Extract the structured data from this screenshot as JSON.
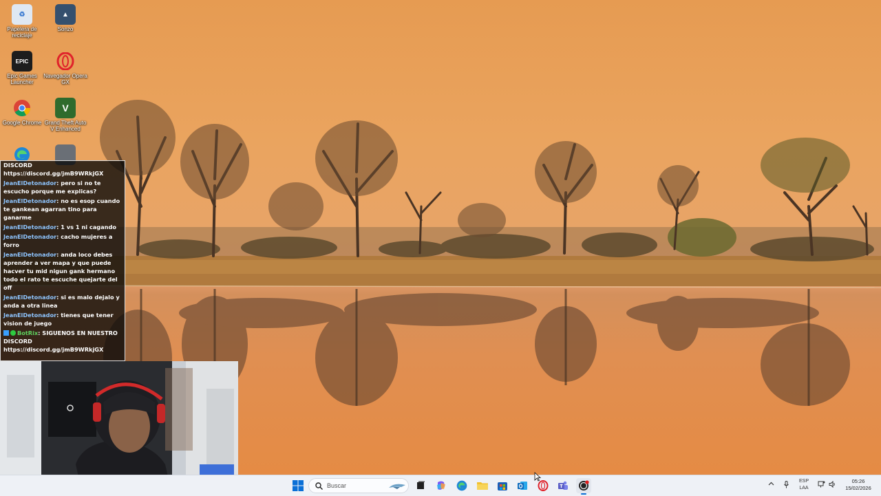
{
  "desktop": {
    "icons": [
      {
        "label": "Papelera de reciclaje",
        "icon": "recycle-bin-icon",
        "color": "#dfe8f3"
      },
      {
        "label": "Sonzo",
        "icon": "game-shortcut-icon",
        "color": "#35506e"
      },
      {
        "label": "Epic Games Launcher",
        "icon": "epic-games-icon",
        "color": "#1d1d1d"
      },
      {
        "label": "Navegador Opera GX",
        "icon": "opera-gx-icon",
        "color": "#e0222a"
      },
      {
        "label": "Google Chrome",
        "icon": "chrome-icon",
        "color": "#4285f4"
      },
      {
        "label": "Grand Theft Auto V Enhanced",
        "icon": "gta-v-icon",
        "color": "#2f6b2d"
      },
      {
        "label": "Microsoft Edge",
        "icon": "edge-icon",
        "color": "#1e88d6"
      },
      {
        "label": "",
        "icon": "generic-shortcut-icon",
        "color": "#6a6f76"
      }
    ]
  },
  "chat": {
    "header": "DISCORD",
    "messages": [
      {
        "user": "",
        "text": "https://discord.gg/jmB9WRkjGX"
      },
      {
        "user": "JeanElDetonador",
        "text": ": pero si no te escucho porque me explicas?"
      },
      {
        "user": "JeanElDetonador",
        "text": ": no es esop cuando te gankean agarran tino para ganarme"
      },
      {
        "user": "JeanElDetonador",
        "text": ": 1 vs 1 ni cagando"
      },
      {
        "user": "JeanElDetonador",
        "text": ": cacho mujeres a forro"
      },
      {
        "user": "JeanElDetonador",
        "text": ": anda loco debes aprender a ver mapa y que puede hacver tu mid nigun gank hermano todo el rato te escuche quejarte del off"
      },
      {
        "user": "JeanElDetonador",
        "text": ": si es malo dejalo y anda a otra linea"
      },
      {
        "user": "JeanElDetonador",
        "text": ": tienes que tener vision de juego"
      }
    ],
    "bot_message": {
      "user": "BotRix",
      "text": ": SIGUENOS EN NUESTRO DISCORD",
      "link": "https://discord.gg/jmB9WRkjGX"
    }
  },
  "taskbar": {
    "search_placeholder": "Buscar",
    "apps": [
      {
        "name": "start-button",
        "icon": "windows-logo-icon",
        "color": "#0a6fd6"
      },
      {
        "name": "task-view-button",
        "icon": "task-view-icon",
        "color": "#202020"
      },
      {
        "name": "copilot-button",
        "icon": "copilot-icon",
        "color": "#7a5af8"
      },
      {
        "name": "edge-taskbar-button",
        "icon": "edge-icon",
        "color": "#1e88d6"
      },
      {
        "name": "file-explorer-button",
        "icon": "folder-icon",
        "color": "#f2c12e"
      },
      {
        "name": "store-button",
        "icon": "store-icon",
        "color": "#1b5fb8"
      },
      {
        "name": "outlook-button",
        "icon": "outlook-icon",
        "color": "#0f6cbd"
      },
      {
        "name": "opera-taskbar-button",
        "icon": "opera-gx-icon",
        "color": "#e0222a"
      },
      {
        "name": "teams-button",
        "icon": "teams-icon",
        "color": "#5b5fc7"
      },
      {
        "name": "obs-button",
        "icon": "recording-app-icon",
        "color": "#222222"
      }
    ],
    "tray": {
      "language_line1": "ESP",
      "language_line2": "LAA",
      "time": "05:26",
      "date": "15/02/2026"
    }
  },
  "colors": {
    "sky": "#e9a15b",
    "water": "#e58b44",
    "chat_username": "#8ec5ff",
    "bot_username": "#5fd35f"
  }
}
